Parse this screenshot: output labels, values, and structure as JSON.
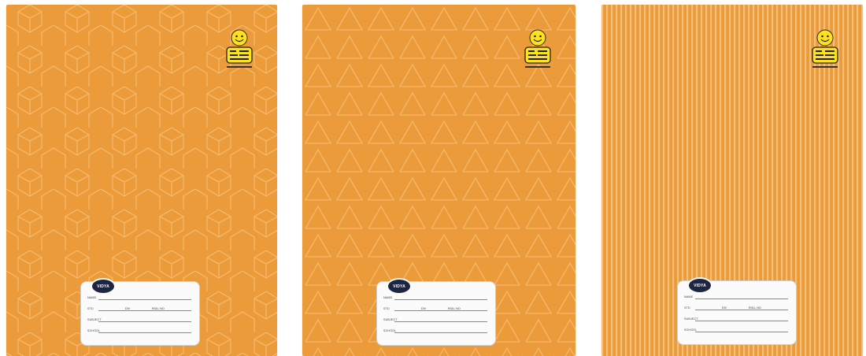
{
  "cover_color": "#ec9b3b",
  "pattern_color": "#f6c47e",
  "notebooks": [
    {
      "pattern": "hexagon-cube"
    },
    {
      "pattern": "triangles"
    },
    {
      "pattern": "vertical-stripes"
    }
  ],
  "logo": {
    "icon": "smiley-mascot-icon"
  },
  "label": {
    "badge": "VIDYA",
    "fields": {
      "name": "NAME",
      "std": "STD",
      "div": "DIV",
      "roll_no": "ROLL NO",
      "subject": "SUBJECT",
      "school": "SCHOOL"
    }
  }
}
